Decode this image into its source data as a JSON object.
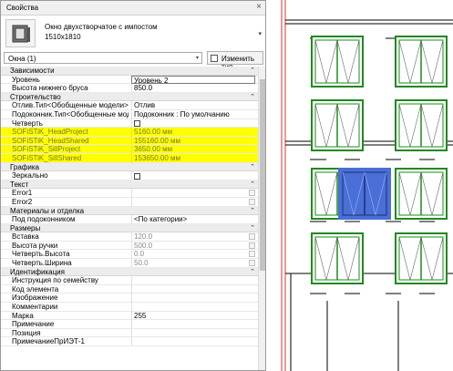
{
  "panel": {
    "title": "Свойства",
    "type_name": "Окно двухстворчатое с импостом",
    "type_size": "1510x1810",
    "selector_value": "Окна (1)",
    "edit_type_label": "Изменить тип"
  },
  "rows": [
    {
      "kind": "section",
      "name": "Зависимости"
    },
    {
      "name": "Уровень",
      "value": "Уровень 2",
      "style": "edit"
    },
    {
      "name": "Высота нижнего бруса",
      "value": "850.0"
    },
    {
      "kind": "section",
      "name": "Строительство"
    },
    {
      "name": "Отлив.Тип<Обобщенные модели>",
      "value": "Отлив"
    },
    {
      "name": "Подоконник.Тип<Обобщенные моде...",
      "value": "Подоконник : По умолчанию"
    },
    {
      "name": "Четверть",
      "value": "",
      "checkbox": true
    },
    {
      "name": "SOFiSTiK_HeadProject",
      "value": "5160.00 мм",
      "highlight": true
    },
    {
      "name": "SOFiSTiK_HeadShared",
      "value": "155160.00 мм",
      "highlight": true
    },
    {
      "name": "SOFiSTiK_SillProject",
      "value": "3650.00 мм",
      "highlight": true
    },
    {
      "name": "SOFiSTiK_SillShared",
      "value": "153650.00 мм",
      "highlight": true
    },
    {
      "kind": "section",
      "name": "Графика"
    },
    {
      "name": "Зеркально",
      "value": "",
      "checkbox": true
    },
    {
      "kind": "section",
      "name": "Текст"
    },
    {
      "name": "Error1",
      "value": "",
      "button": true
    },
    {
      "name": "Error2",
      "value": "",
      "button": true
    },
    {
      "kind": "section",
      "name": "Материалы и отделка"
    },
    {
      "name": "Под подоконником",
      "value": "<По категории>"
    },
    {
      "kind": "section",
      "name": "Размеры"
    },
    {
      "name": "Вставка",
      "value": "120.0",
      "button": true
    },
    {
      "name": "Высота ручки",
      "value": "500.0",
      "button": true
    },
    {
      "name": "Четверть.Высота",
      "value": "0.0",
      "button": true
    },
    {
      "name": "Четверть.Ширина",
      "value": "50.0",
      "button": true
    },
    {
      "kind": "section",
      "name": "Идентификация"
    },
    {
      "name": "Инструкция по семейству",
      "value": ""
    },
    {
      "name": "Код элемента",
      "value": ""
    },
    {
      "name": "Изображение",
      "value": ""
    },
    {
      "name": "Комментарии",
      "value": ""
    },
    {
      "name": "Марка",
      "value": "255"
    },
    {
      "name": "Примечание",
      "value": ""
    },
    {
      "name": "Позиция",
      "value": ""
    },
    {
      "name": "ПримечаниеПрИЭТ-1",
      "value": ""
    }
  ],
  "colors": {
    "highlight": "#ffff00",
    "selected_window": "#4a6fd6",
    "window_frame": "#1e8a1e"
  },
  "icons": {
    "section_collapse": "⌃",
    "type_dropdown": "▾",
    "close": "×"
  }
}
